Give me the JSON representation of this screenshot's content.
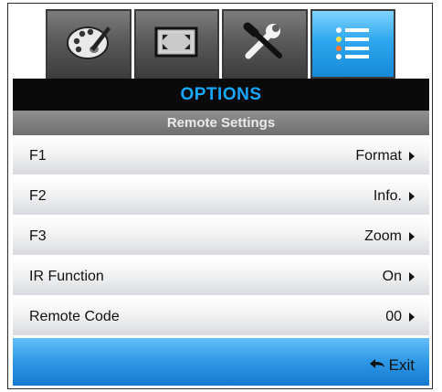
{
  "tabs": [
    {
      "id": "image",
      "icon": "palette-icon",
      "active": false
    },
    {
      "id": "display",
      "icon": "screen-resize-icon",
      "active": false
    },
    {
      "id": "setup",
      "icon": "tools-icon",
      "active": false
    },
    {
      "id": "options",
      "icon": "options-list-icon",
      "active": true
    }
  ],
  "header": {
    "title": "OPTIONS"
  },
  "subheader": {
    "title": "Remote Settings"
  },
  "rows": [
    {
      "label": "F1",
      "value": "Format"
    },
    {
      "label": "F2",
      "value": "Info."
    },
    {
      "label": "F3",
      "value": "Zoom"
    },
    {
      "label": "IR Function",
      "value": "On"
    },
    {
      "label": "Remote Code",
      "value": "00"
    }
  ],
  "footer": {
    "exit_label": "Exit",
    "exit_icon": "return-arrow-icon"
  },
  "colors": {
    "accent_blue": "#19A7FF",
    "header_bg": "#0A0A0A",
    "subheader_bg": "#7F7F7F",
    "footer_blue": "#2E98E6"
  }
}
